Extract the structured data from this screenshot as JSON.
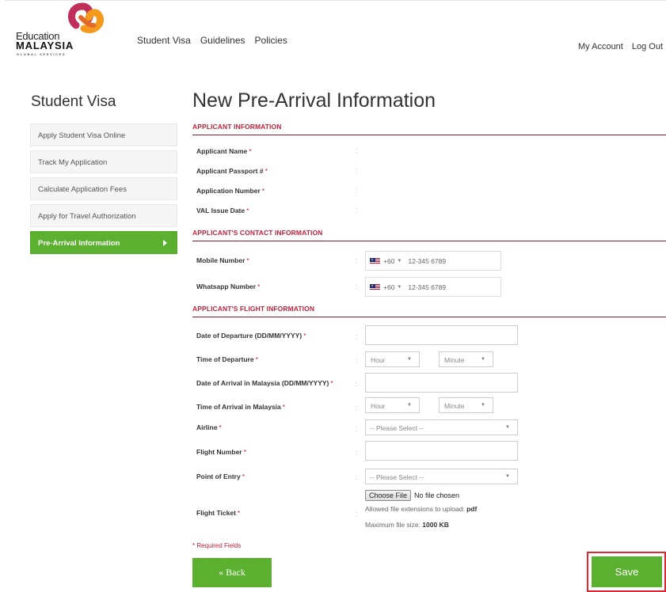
{
  "brand": {
    "line1": "Education",
    "line2": "MALAYSIA",
    "line3": "GLOBAL SERVICES",
    "colors": {
      "orange": "#f39a1e",
      "magenta": "#c0305a",
      "dark": "#111111"
    }
  },
  "top_nav": [
    "Student Visa",
    "Guidelines",
    "Policies"
  ],
  "account_nav": [
    "My Account",
    "Log Out"
  ],
  "sidebar": {
    "title": "Student Visa",
    "items": [
      {
        "label": "Apply Student Visa Online",
        "active": false
      },
      {
        "label": "Track My Application",
        "active": false
      },
      {
        "label": "Calculate Application Fees",
        "active": false
      },
      {
        "label": "Apply for Travel Authorization",
        "active": false
      },
      {
        "label": "Pre-Arrival Information",
        "active": true
      }
    ]
  },
  "page_title": "New Pre-Arrival Information",
  "sections": {
    "applicant": {
      "header": "APPLICANT INFORMATION",
      "fields": {
        "name": "Applicant Name",
        "passport": "Applicant Passport #",
        "app_number": "Application Number",
        "val_date": "VAL Issue Date"
      }
    },
    "contact": {
      "header": "APPLICANT'S CONTACT INFORMATION",
      "mobile_label": "Mobile Number",
      "whatsapp_label": "Whatsapp Number",
      "country_code": "+60",
      "phone_placeholder": "12-345 6789"
    },
    "flight": {
      "header": "APPLICANT'S FLIGHT INFORMATION",
      "departure_date_label": "Date of Departure (DD/MM/YYYY)",
      "departure_time_label": "Time of Departure",
      "arrival_date_label": "Date of Arrival in Malaysia (DD/MM/YYYY)",
      "arrival_time_label": "Time of Arrival in Malaysia",
      "airline_label": "Airline",
      "flight_number_label": "Flight Number",
      "entry_label": "Point of Entry",
      "ticket_label": "Flight Ticket",
      "hour_placeholder": "Hour",
      "minute_placeholder": "Minute",
      "select_placeholder": "-- Please Select --",
      "choose_file": "Choose File",
      "no_file": "No file chosen",
      "ext_text": "Allowed file extensions to upload:",
      "ext_value": "pdf",
      "size_text": "Maximum file size:",
      "size_value": "1000 KB"
    }
  },
  "required_marker": "*",
  "colon": ":",
  "required_note": "* Required Fields",
  "buttons": {
    "back": "« Back",
    "save": "Save"
  }
}
